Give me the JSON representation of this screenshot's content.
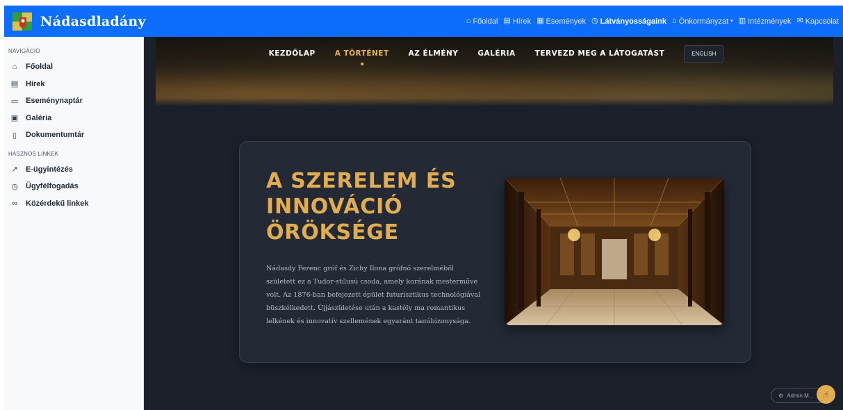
{
  "header": {
    "brand": "Nádasdladány",
    "nav": [
      {
        "icon": "home-icon",
        "glyph": "⌂",
        "label": "Főoldal"
      },
      {
        "icon": "newspaper-icon",
        "glyph": "▤",
        "label": "Hírek"
      },
      {
        "icon": "calendar-icon",
        "glyph": "▦",
        "label": "Események"
      },
      {
        "icon": "landmark-icon",
        "glyph": "◷",
        "label": "Látványosságaink"
      },
      {
        "icon": "bank-icon",
        "glyph": "⌂",
        "label": "Önkormányzat"
      },
      {
        "icon": "building-icon",
        "glyph": "▥",
        "label": "Intézmények"
      },
      {
        "icon": "envelope-icon",
        "glyph": "✉",
        "label": "Kapcsolat"
      }
    ]
  },
  "sidebar": {
    "nav_heading": "NAVIGÁCIÓ",
    "nav_items": [
      {
        "icon": "home-outline-icon",
        "glyph": "⌂",
        "label": "Főoldal"
      },
      {
        "icon": "newspaper-icon",
        "glyph": "▤",
        "label": "Hírek"
      },
      {
        "icon": "calendar-icon",
        "glyph": "▭",
        "label": "Eseménynaptár"
      },
      {
        "icon": "image-icon",
        "glyph": "▣",
        "label": "Galéria"
      },
      {
        "icon": "file-icon",
        "glyph": "▯",
        "label": "Dokumentumtár"
      }
    ],
    "links_heading": "HASZNOS LINKEK",
    "link_items": [
      {
        "icon": "external-link-icon",
        "glyph": "↗",
        "label": "E-ügyintézés"
      },
      {
        "icon": "clock-icon",
        "glyph": "◷",
        "label": "Ügyfélfogadás"
      },
      {
        "icon": "link-icon",
        "glyph": "∞",
        "label": "Közérdekű linkek"
      }
    ]
  },
  "main_nav": {
    "items": [
      "KEZDŐLAP",
      "A TÖRTÉNET",
      "AZ ÉLMÉNY",
      "GALÉRIA",
      "TERVEZD MEG A LÁTOGATÁST"
    ],
    "active": "A TÖRTÉNET",
    "lang_button": "ENGLISH"
  },
  "story": {
    "title": "A SZERELEM ÉS INNOVÁCIÓ ÖRÖKSÉGE",
    "text": "Nádasdy Ferenc gróf és Zichy Ilona grófnő szerelméből született ez a Tudor-stílusú csoda, amely korának mesterműve volt. Az 1876-ban befejezett épület futurisztikus technológiával büszkélkedett. Újjászületése után a kastély ma romantikus lelkének és innovatív szellemének egyaránt tanúbizonysága."
  },
  "admin": {
    "label": "Admin M..."
  },
  "colors": {
    "header_blue": "#0d6efd",
    "gold_accent": "#e2ad4e",
    "dark_bg": "#1b202a",
    "card_bg": "#232a36"
  }
}
